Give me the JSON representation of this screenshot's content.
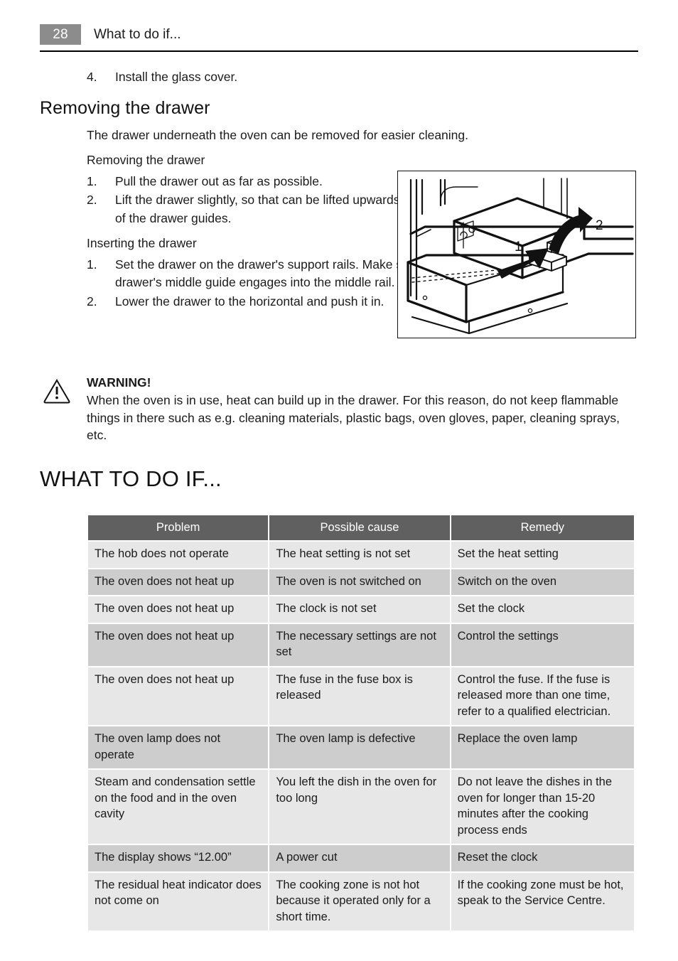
{
  "header": {
    "page_number": "28",
    "title": "What to do if..."
  },
  "intro_list": [
    {
      "marker": "4.",
      "text": "Install the glass cover."
    }
  ],
  "drawer_section": {
    "heading": "Removing the drawer",
    "intro": "The drawer underneath the oven can be removed for easier cleaning.",
    "removing_subhead": "Removing the drawer",
    "removing_steps": [
      {
        "marker": "1.",
        "text": "Pull the drawer out as far as possible."
      },
      {
        "marker": "2.",
        "text": "Lift the drawer slightly, so that can be lifted upwards at an angle of the drawer guides."
      }
    ],
    "inserting_subhead": "Inserting the drawer",
    "inserting_steps": [
      {
        "marker": "1.",
        "text": "Set the drawer on the drawer's support rails. Make sure that drawer's middle guide engages into the middle rail."
      },
      {
        "marker": "2.",
        "text": "Lower the drawer to the horizontal and push it in."
      }
    ]
  },
  "figure": {
    "label_1": "1",
    "label_2": "2"
  },
  "warning": {
    "title": "WARNING!",
    "text": "When the oven is in use, heat can build up in the drawer. For this reason, do not keep flammable things in there such as e.g. cleaning materials, plastic bags, oven gloves, paper, cleaning sprays, etc."
  },
  "chapter_title": "WHAT TO DO IF...",
  "table": {
    "columns": [
      "Problem",
      "Possible cause",
      "Remedy"
    ],
    "rows": [
      [
        "The hob does not operate",
        "The heat setting is not set",
        "Set the heat setting"
      ],
      [
        "The oven does not heat up",
        "The oven is not switched on",
        "Switch on the oven"
      ],
      [
        "The oven does not heat up",
        "The clock is not set",
        "Set the clock"
      ],
      [
        "The oven does not heat up",
        "The necessary settings are not set",
        "Control the settings"
      ],
      [
        "The oven does not heat up",
        "The fuse in the fuse box is released",
        "Control the fuse. If the fuse is released more than one time, refer to a qualified electrician."
      ],
      [
        "The oven lamp does not operate",
        "The oven lamp is defective",
        "Replace the oven lamp"
      ],
      [
        "Steam and condensation settle on the food and in the oven cavity",
        "You left the dish in the oven for too long",
        "Do not leave the dishes in the oven for longer than 15-20 minutes after the cooking process ends"
      ],
      [
        "The display shows “12.00”",
        "A power cut",
        "Reset the clock"
      ],
      [
        "The residual heat indicator does not come on",
        "The cooking zone is not hot because it operated only for a short time.",
        "If the cooking zone must be hot, speak to the Service Centre."
      ]
    ]
  },
  "colors": {
    "page_number_bg": "#8c8c8c",
    "table_header_bg": "#606060",
    "row_light": "#e7e7e7",
    "row_dark": "#cdcdcd",
    "rule": "#000000"
  }
}
